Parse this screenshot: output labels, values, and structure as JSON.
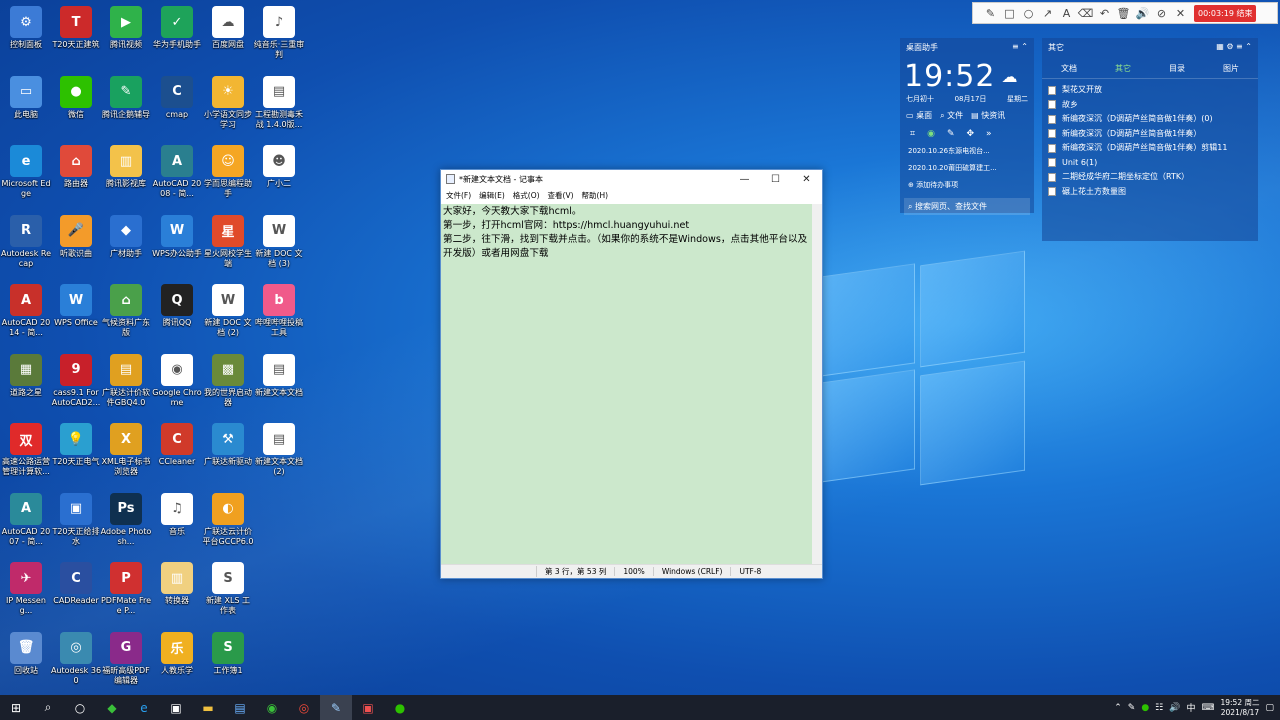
{
  "desktop_icons": [
    {
      "label": "控制面板",
      "color": "#3c7bd6",
      "glyph": "⚙"
    },
    {
      "label": "T20天正建筑",
      "color": "#cc2a2a",
      "glyph": "T"
    },
    {
      "label": "腾讯视频",
      "color": "#2fb24a",
      "glyph": "▶"
    },
    {
      "label": "华为手机助手",
      "color": "#1ea35a",
      "glyph": "✓"
    },
    {
      "label": "百度网盘",
      "color": "#ffffff",
      "glyph": "☁"
    },
    {
      "label": "纯音乐·三重审判",
      "color": "#ffffff",
      "glyph": "♪"
    },
    {
      "label": "此电脑",
      "color": "#4a8fe0",
      "glyph": "▭"
    },
    {
      "label": "微信",
      "color": "#2dc100",
      "glyph": "●"
    },
    {
      "label": "腾讯企鹅辅导",
      "color": "#19a15f",
      "glyph": "✎"
    },
    {
      "label": "cmap",
      "color": "#1c4f8f",
      "glyph": "C"
    },
    {
      "label": "小学语文同步学习",
      "color": "#f2b632",
      "glyph": "☀"
    },
    {
      "label": "工程勘测毒禾战 1.4.0版...",
      "color": "#ffffff",
      "glyph": "▤"
    },
    {
      "label": "Microsoft Edge",
      "color": "#1b8ad8",
      "glyph": "e"
    },
    {
      "label": "路由器",
      "color": "#e04a3a",
      "glyph": "⌂"
    },
    {
      "label": "腾讯影视库",
      "color": "#f3c24a",
      "glyph": "▥"
    },
    {
      "label": "AutoCAD 2008 - 简...",
      "color": "#2a7f8f",
      "glyph": "A"
    },
    {
      "label": "学而思编程助手",
      "color": "#f5a623",
      "glyph": "☺"
    },
    {
      "label": "广小二",
      "color": "#ffffff",
      "glyph": "☻"
    },
    {
      "label": "Autodesk Recap",
      "color": "#2a5faa",
      "glyph": "R"
    },
    {
      "label": "听歌识曲",
      "color": "#f39b2a",
      "glyph": "🎤"
    },
    {
      "label": "广材助手",
      "color": "#2a6fd0",
      "glyph": "◆"
    },
    {
      "label": "WPS办公助手",
      "color": "#2a7fd8",
      "glyph": "W"
    },
    {
      "label": "星火网校学生端",
      "color": "#e04a2a",
      "glyph": "星"
    },
    {
      "label": "新建 DOC 文档 (3)",
      "color": "#ffffff",
      "glyph": "W"
    },
    {
      "label": "AutoCAD 2014 - 简...",
      "color": "#c8302a",
      "glyph": "A"
    },
    {
      "label": "WPS Office",
      "color": "#2a7fd8",
      "glyph": "W"
    },
    {
      "label": "气候资料广东版",
      "color": "#4aa04a",
      "glyph": "⌂"
    },
    {
      "label": "腾讯QQ",
      "color": "#222222",
      "glyph": "Q"
    },
    {
      "label": "新建 DOC 文档 (2)",
      "color": "#ffffff",
      "glyph": "W"
    },
    {
      "label": "哔哩哔哩投稿工具",
      "color": "#f05a8a",
      "glyph": "b"
    },
    {
      "label": "道路之星",
      "color": "#5a7a3a",
      "glyph": "▦"
    },
    {
      "label": "cass9.1 For AutoCAD2...",
      "color": "#c8202a",
      "glyph": "9"
    },
    {
      "label": "广联达计价软件GBQ4.0",
      "color": "#e0a020",
      "glyph": "▤"
    },
    {
      "label": "Google Chrome",
      "color": "#ffffff",
      "glyph": "◉"
    },
    {
      "label": "我的世界启动器",
      "color": "#6a8a3a",
      "glyph": "▩"
    },
    {
      "label": "新建文本文档",
      "color": "#ffffff",
      "glyph": "▤"
    },
    {
      "label": "高速公路运营管理计算软...",
      "color": "#e02a2a",
      "glyph": "双"
    },
    {
      "label": "T20天正电气",
      "color": "#2a9fd0",
      "glyph": "💡"
    },
    {
      "label": "XML电子标书浏览器",
      "color": "#e0a020",
      "glyph": "X"
    },
    {
      "label": "CCleaner",
      "color": "#d03a2a",
      "glyph": "C"
    },
    {
      "label": "广联达新驱动",
      "color": "#2a8ad0",
      "glyph": "⚒"
    },
    {
      "label": "新建文本文档 (2)",
      "color": "#ffffff",
      "glyph": "▤"
    },
    {
      "label": "AutoCAD 2007 - 简...",
      "color": "#2a8a9a",
      "glyph": "A"
    },
    {
      "label": "T20天正给排水",
      "color": "#2a6fd0",
      "glyph": "▣"
    },
    {
      "label": "Adobe Photosh...",
      "color": "#0f3050",
      "glyph": "Ps"
    },
    {
      "label": "音乐",
      "color": "#ffffff",
      "glyph": "♫"
    },
    {
      "label": "广联达云计价平台GCCP6.0",
      "color": "#f0a020",
      "glyph": "◐"
    },
    {
      "label": "IP Messeng...",
      "color": "#c02a6a",
      "glyph": "✈"
    },
    {
      "label": "CADReader",
      "color": "#2a4fa0",
      "glyph": "C"
    },
    {
      "label": "PDFMate Free P...",
      "color": "#d03030",
      "glyph": "P"
    },
    {
      "label": "转换器",
      "color": "#f0d080",
      "glyph": "▥"
    },
    {
      "label": "新建 XLS 工作表",
      "color": "#ffffff",
      "glyph": "S"
    },
    {
      "label": "回收站",
      "color": "#5a8ad0",
      "glyph": "🗑"
    },
    {
      "label": "Autodesk 360",
      "color": "#3a8ab0",
      "glyph": "◎"
    },
    {
      "label": "福昕高级PDF编辑器",
      "color": "#8a2a8a",
      "glyph": "G"
    },
    {
      "label": "人教乐学",
      "color": "#f0b020",
      "glyph": "乐"
    },
    {
      "label": "工作簿1",
      "color": "#2a9a4a",
      "glyph": "S"
    }
  ],
  "recording_bar": {
    "tools": [
      "✎",
      "□",
      "○",
      "↗",
      "A",
      "⌫",
      "↶",
      "🗑",
      "🔊",
      "⊘",
      "✕"
    ],
    "timer": "00:03:19 结束"
  },
  "assistant": {
    "title": "桌面助手",
    "time": "19:52",
    "lunar": "七月初十",
    "date": "08月17日",
    "weekday": "星期二",
    "btn_desktop": "桌面",
    "btn_file": "文件",
    "btn_quick": "快资讯",
    "todo1": "2020.10.26东源电视台...",
    "todo2": "2020.10.20莆田硫算建工...",
    "add_todo": "添加待办事项",
    "search_placeholder": "搜索网页、查找文件"
  },
  "others": {
    "title": "其它",
    "tabs": [
      "文档",
      "其它",
      "目录",
      "图片"
    ],
    "items": [
      "梨花又开放",
      "故乡",
      "新编夜深沉（D调葫芦丝简音做1伴奏）(0)",
      "新编夜深沉（D调葫芦丝简音做1伴奏）",
      "新编夜深沉（D调葫芦丝简音做1伴奏）剪辑11",
      "Unit 6(1)",
      "二期经成华府二期坐标定位（RTK）",
      "碾上花土方数量图"
    ]
  },
  "notepad": {
    "title": "*新建文本文档 - 记事本",
    "menu": [
      "文件(F)",
      "编辑(E)",
      "格式(O)",
      "查看(V)",
      "帮助(H)"
    ],
    "content": "大家好，今天教大家下载hcml。\n第一步，打开hcml官网：https://hmcl.huangyuhui.net\n第二步，往下滑，找到下载并点击。（如果你的系统不是Windows，点击其他平台以及开发版）或者用网盘下载",
    "status_pos": "第 3 行，第 53 列",
    "status_zoom": "100%",
    "status_eol": "Windows (CRLF)",
    "status_enc": "UTF-8"
  },
  "taskbar": {
    "clock_time": "19:52 周二",
    "clock_date": "2021/8/17",
    "ime": "中"
  }
}
